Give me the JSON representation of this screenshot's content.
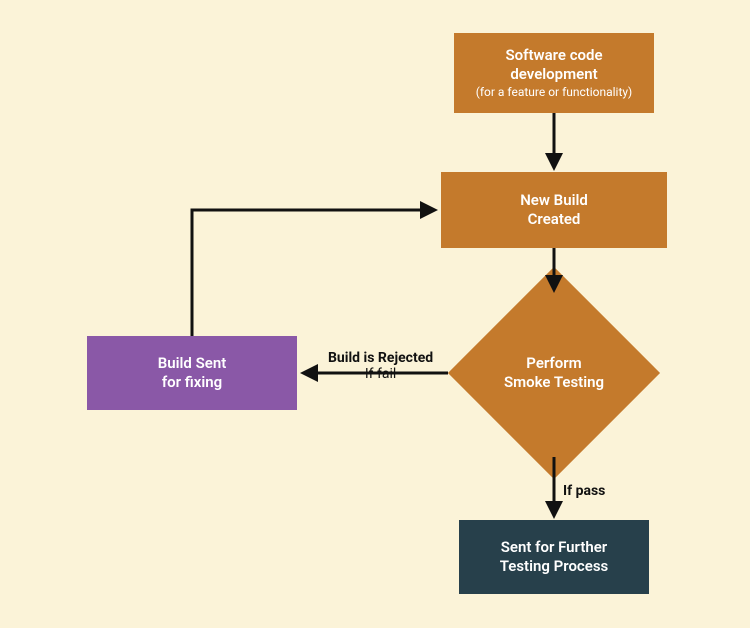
{
  "nodes": {
    "dev": {
      "line1": "Software code",
      "line2": "development",
      "sub": "(for a feature or functionality)"
    },
    "build": {
      "line1": "New  Build",
      "line2": "Created"
    },
    "smoke": {
      "line1": "Perform",
      "line2": "Smoke Testing"
    },
    "fix": {
      "line1": "Build Sent",
      "line2": "for fixing"
    },
    "further": {
      "line1": "Sent for Further",
      "line2": "Testing Process"
    }
  },
  "edges": {
    "fail": {
      "top": "Build is Rejected",
      "bottom": "If fail"
    },
    "pass": {
      "label": "If pass"
    }
  },
  "colors": {
    "orange": "#c47a2c",
    "purple": "#8a58a7",
    "dark": "#27404b",
    "bg": "#fbf3d8"
  }
}
